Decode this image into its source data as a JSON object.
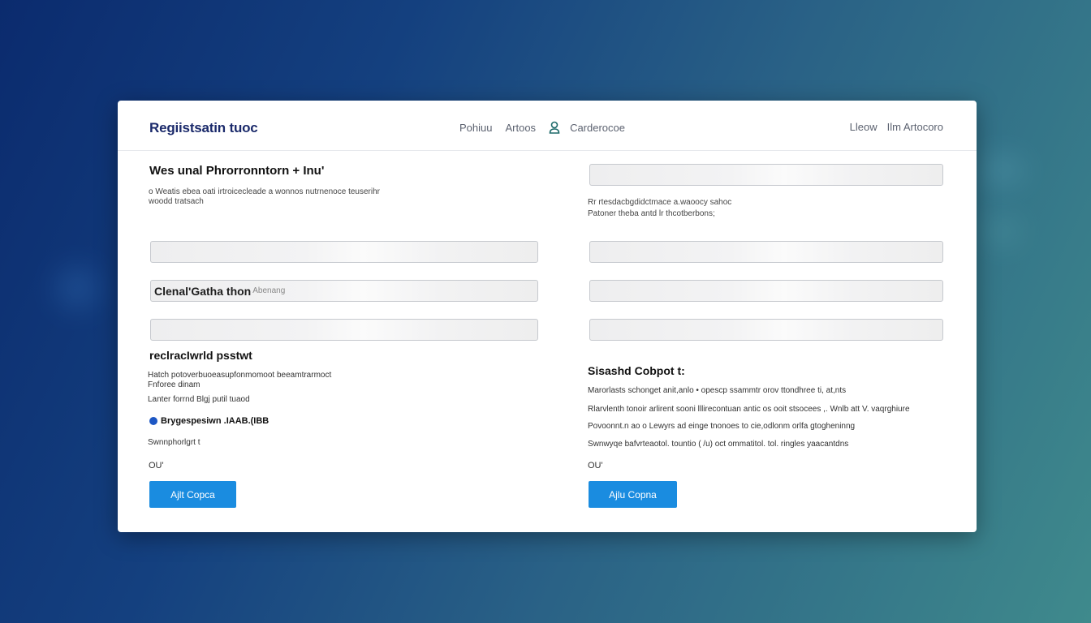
{
  "header": {
    "brand": "Regiistsatin tuoc",
    "nav_links": [
      "Pohiuu",
      "Artoos"
    ],
    "user_label": "Carderocoe",
    "right_links": [
      "Lleow",
      "Ilm Artocoro"
    ]
  },
  "left": {
    "title": "Wes unal Phrorronntorn + Inu'",
    "desc_line1": "o   Weatis ebea oati irtroicecleade a wonnos nutrnenoce teuserihr",
    "desc_line2": "woodd tratsach",
    "fields": [
      {
        "value": "",
        "placeholder": ""
      },
      {
        "value": "Clenal'Gatha thon",
        "placeholder": "Abenang"
      },
      {
        "value": "",
        "placeholder": ""
      }
    ],
    "section2_title": "reclracIwrld psstwt",
    "section2_line1": "Hatch potoverbuoeasupfonmomoot beeamtrarmoct",
    "section2_line2": "Fnforee dinam",
    "section2_line3": "Lanter forrnd Blgj putil tuaod",
    "radio_label": "Brygespesiwn .IAAB.(IBB",
    "extra_line": "Swnnphorlgrt t",
    "out_label": "OU'",
    "button_label": "Ajlt Copca"
  },
  "right": {
    "top_field": {
      "value": "",
      "placeholder": ""
    },
    "desc_line1": "Rr   rtesdacbgdidctmace a.waoocy sahoc",
    "desc_line2": "Patoner theba  antd  lr thcotberbons;",
    "fields": [
      {
        "value": "",
        "placeholder": ""
      },
      {
        "value": "",
        "placeholder": ""
      },
      {
        "value": "",
        "placeholder": ""
      }
    ],
    "section2_title": "Sisashd Cobpot t:",
    "lines": [
      "Marorlasts schonget anit,anlo • opescp ssammtr orov ttondhree ti, at,nts",
      "Rlarvlenth  tonoir arlirent  sooni lllirecontuan   antic os ooit  stsocees ,.  Wnlb  att  V. vaqrghiure",
      "Povoonnt.n  ao o  Lewyrs ad  einge tnonoes to cie,odlonm orlfa gtogheninng",
      "Swnwyqe bafvrteaotol. tountio  (  /u)  oct ommatitol.  tol.  ringles  yaacantdns"
    ],
    "out_label": "OU'",
    "button_label": "Ajlu Copna"
  },
  "colors": {
    "accent": "#1a8ce0",
    "brand": "#1b2a6b",
    "radio": "#1d57c4"
  }
}
